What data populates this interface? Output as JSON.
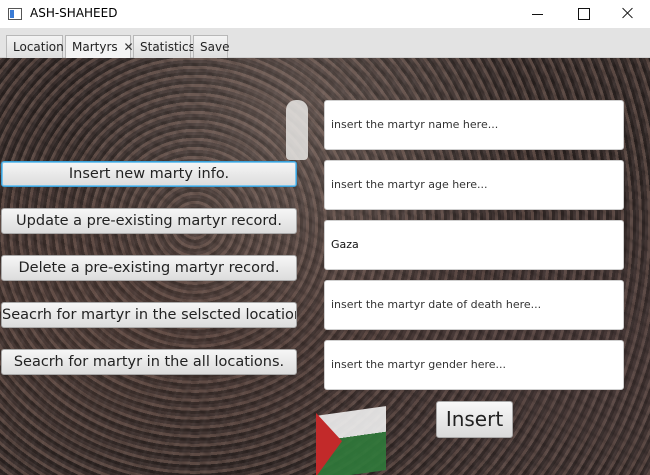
{
  "window": {
    "title": "ASH-SHAHEED"
  },
  "tabs": [
    {
      "label": "Location",
      "active": false
    },
    {
      "label": "Martyrs",
      "active": true,
      "closable": true
    },
    {
      "label": "Statistics",
      "active": false
    },
    {
      "label": "Save",
      "active": false
    }
  ],
  "actions": [
    {
      "label": "Insert new marty info.",
      "focused": true
    },
    {
      "label": "Update a pre-existing martyr record."
    },
    {
      "label": "Delete a pre-existing martyr record."
    },
    {
      "label": "Seacrh for martyr in the selscted location."
    },
    {
      "label": "Seacrh for martyr in the all locations."
    }
  ],
  "form": {
    "name": {
      "placeholder": "insert the martyr name here...",
      "value": ""
    },
    "age": {
      "placeholder": "insert the martyr age here...",
      "value": ""
    },
    "location": {
      "placeholder": "",
      "value": "Gaza"
    },
    "date_of_death": {
      "placeholder": "insert the martyr date of death here...",
      "value": ""
    },
    "gender": {
      "placeholder": "insert the martyr gender here...",
      "value": ""
    },
    "submit_label": "Insert"
  },
  "icons": {
    "app": "app-window-icon",
    "tab_close": "close-icon"
  }
}
